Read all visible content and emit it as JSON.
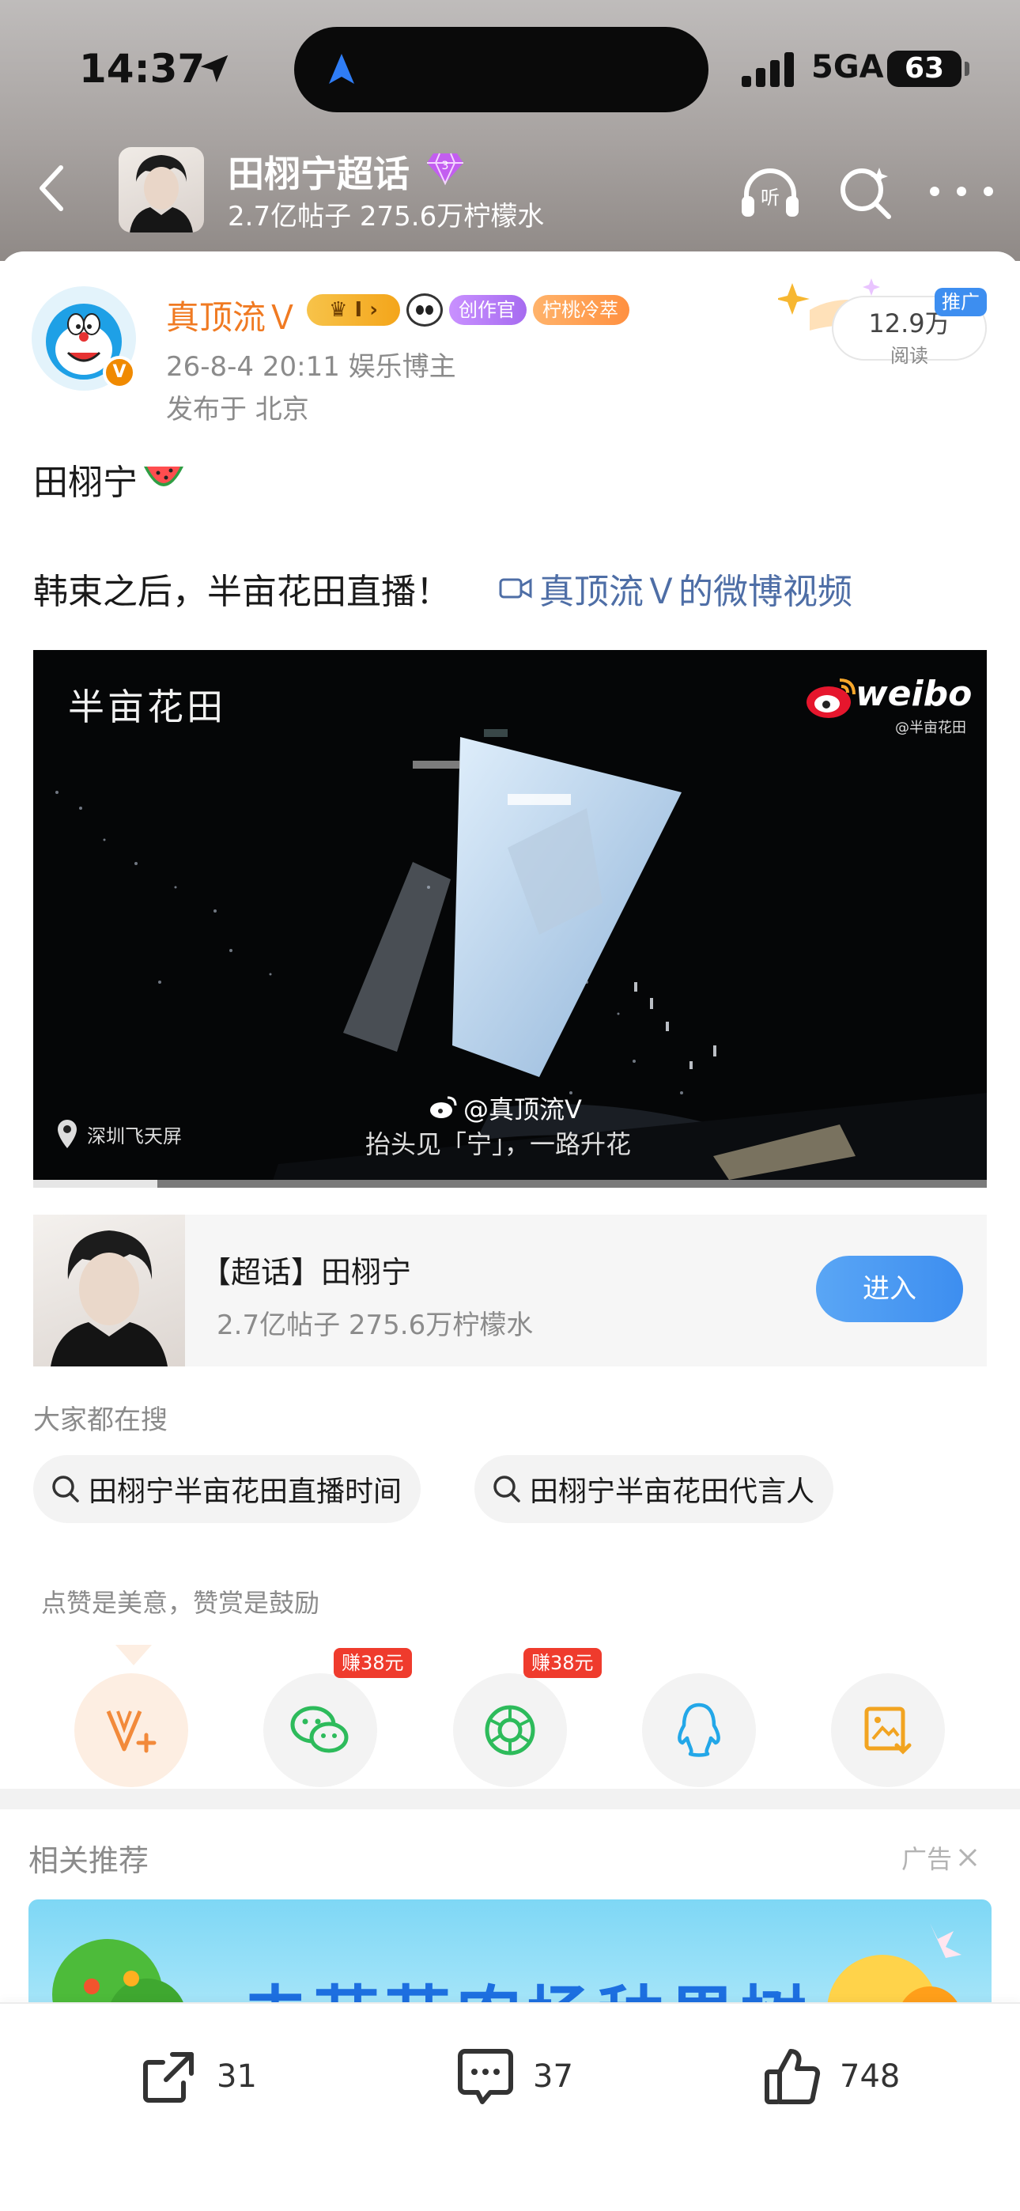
{
  "status_bar": {
    "time": "14:37",
    "network": "5GA",
    "battery": "63"
  },
  "topic": {
    "title": "田栩宁超话",
    "stats": "2.7亿帖子 275.6万柠檬水"
  },
  "post": {
    "author": "真顶流Ｖ",
    "badges": {
      "level": "I",
      "creator": "创作官",
      "fan": "柠桃冷萃"
    },
    "meta": "26-8-4 20:11  娱乐博主",
    "location": "发布于 北京",
    "read_count": "12.9万",
    "read_label": "阅读",
    "promo_tag": "推广",
    "text_line1": "田栩宁",
    "text_line2": "韩束之后，半亩花田直播！",
    "video_link": "真顶流Ｖ的微博视频"
  },
  "video": {
    "brand": "半亩花田",
    "weibo": "weibo",
    "weibo_sub": "@半亩花田",
    "location": "深圳飞天屏",
    "caption_user": "@真顶流V",
    "caption": "抬头见「宁」，一路升花",
    "progress": 0.13
  },
  "supertopic_card": {
    "title": "【超话】田栩宁",
    "stats": "2.7亿帖子 275.6万柠檬水",
    "enter": "进入"
  },
  "searches": {
    "title": "大家都在搜",
    "items": [
      "田栩宁半亩花田直播时间",
      "田栩宁半亩花田代言人"
    ]
  },
  "reward": {
    "text": "点赞是美意，赞赏是鼓励",
    "earn_wechat": "赚38元",
    "earn_moments": "赚38元"
  },
  "recommend": {
    "title": "相关推荐",
    "ad_label": "广告",
    "banner_text": "去芭芭农场种果树"
  },
  "actions": {
    "share_count": "31",
    "comment_count": "37",
    "like_count": "748"
  },
  "colors": {
    "accent_blue": "#3d8ef0",
    "author_orange": "#f07a22",
    "earn_red": "#ef3b2d",
    "link_blue": "#4e6ea6"
  },
  "icons": [
    "location-arrow-icon",
    "signal-icon",
    "back-icon",
    "gem-icon",
    "listen-icon",
    "search-sparkle-icon",
    "more-icon",
    "video-camera-icon",
    "search-icon",
    "tip-icon",
    "wechat-icon",
    "moments-icon",
    "qq-icon",
    "save-image-icon",
    "share-icon",
    "comment-icon",
    "like-icon",
    "close-icon"
  ]
}
